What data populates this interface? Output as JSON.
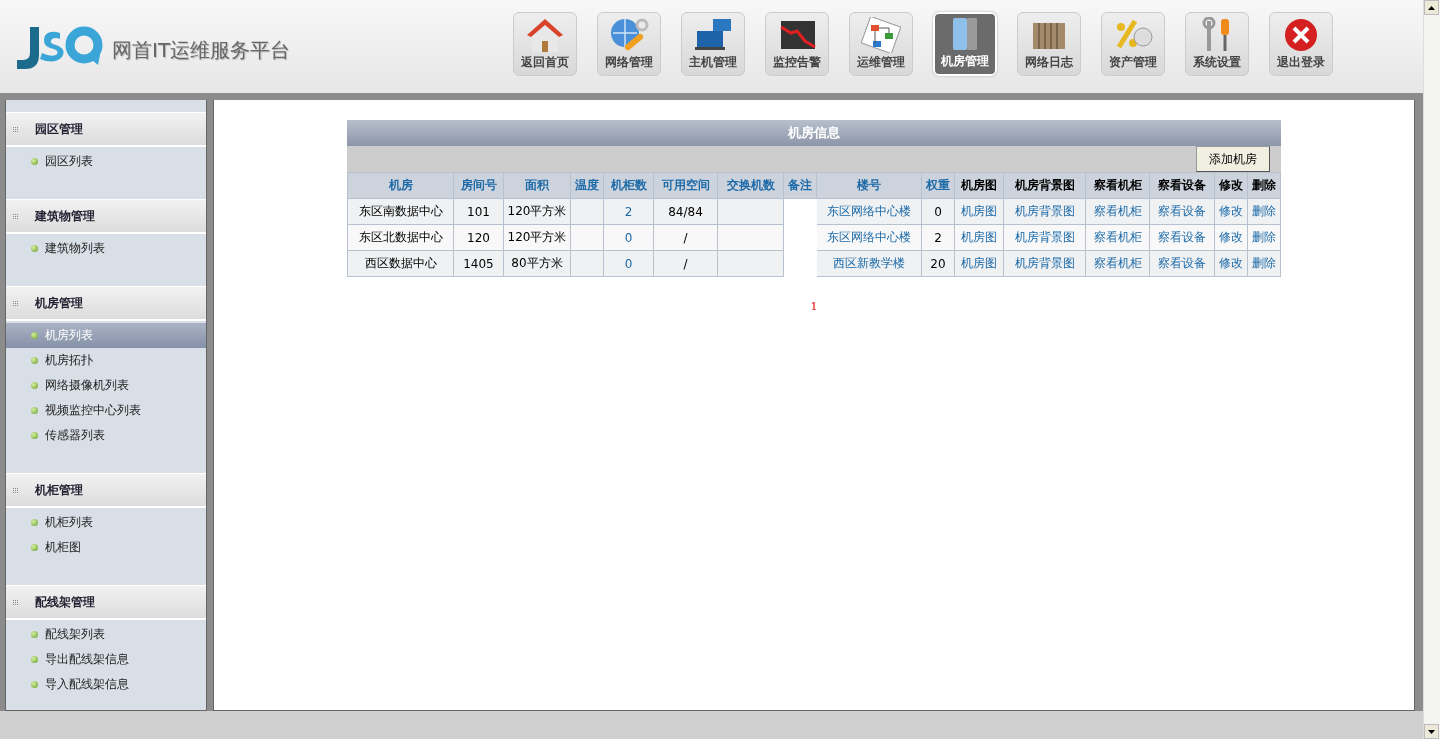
{
  "brand": {
    "title": "网首IT运维服务平台"
  },
  "nav": [
    {
      "label": "返回首页",
      "kind": "home",
      "selected": false
    },
    {
      "label": "网络管理",
      "kind": "network",
      "selected": false
    },
    {
      "label": "主机管理",
      "kind": "host",
      "selected": false
    },
    {
      "label": "监控告警",
      "kind": "monitor",
      "selected": false
    },
    {
      "label": "运维管理",
      "kind": "flow",
      "selected": false
    },
    {
      "label": "机房管理",
      "kind": "room",
      "selected": true
    },
    {
      "label": "网络日志",
      "kind": "log",
      "selected": false
    },
    {
      "label": "资产管理",
      "kind": "asset",
      "selected": false
    },
    {
      "label": "系统设置",
      "kind": "settings",
      "selected": false
    },
    {
      "label": "退出登录",
      "kind": "logout",
      "selected": false
    }
  ],
  "sidebar": {
    "groups": [
      {
        "title": "园区管理",
        "items": [
          {
            "label": "园区列表",
            "selected": false
          }
        ]
      },
      {
        "title": "建筑物管理",
        "items": [
          {
            "label": "建筑物列表",
            "selected": false
          }
        ]
      },
      {
        "title": "机房管理",
        "items": [
          {
            "label": "机房列表",
            "selected": true
          },
          {
            "label": "机房拓扑",
            "selected": false
          },
          {
            "label": "网络摄像机列表",
            "selected": false
          },
          {
            "label": "视频监控中心列表",
            "selected": false
          },
          {
            "label": "传感器列表",
            "selected": false
          }
        ]
      },
      {
        "title": "机柜管理",
        "items": [
          {
            "label": "机柜列表",
            "selected": false
          },
          {
            "label": "机柜图",
            "selected": false
          }
        ]
      },
      {
        "title": "配线架管理",
        "items": [
          {
            "label": "配线架列表",
            "selected": false
          },
          {
            "label": "导出配线架信息",
            "selected": false
          },
          {
            "label": "导入配线架信息",
            "selected": false
          }
        ]
      }
    ]
  },
  "table": {
    "title": "机房信息",
    "add_button": "添加机房",
    "columns": [
      {
        "label": "机房",
        "kind": "sortable"
      },
      {
        "label": "房间号",
        "kind": "sortable"
      },
      {
        "label": "面积",
        "kind": "sortable"
      },
      {
        "label": "温度",
        "kind": "sortable"
      },
      {
        "label": "机柜数",
        "kind": "sortable"
      },
      {
        "label": "可用空间",
        "kind": "sortable"
      },
      {
        "label": "交换机数",
        "kind": "sortable"
      },
      {
        "label": "备注",
        "kind": "sortable"
      },
      {
        "label": "楼号",
        "kind": "sortable"
      },
      {
        "label": "权重",
        "kind": "sortable"
      },
      {
        "label": "机房图",
        "kind": "plain"
      },
      {
        "label": "机房背景图",
        "kind": "plain"
      },
      {
        "label": "察看机柜",
        "kind": "plain"
      },
      {
        "label": "察看设备",
        "kind": "plain"
      },
      {
        "label": "修改",
        "kind": "plain"
      },
      {
        "label": "删除",
        "kind": "plain"
      }
    ],
    "rows": [
      [
        {
          "text": "东区南数据中心",
          "link": false
        },
        {
          "text": "101",
          "link": false
        },
        {
          "text": "120平方米",
          "link": false
        },
        null,
        {
          "text": "2",
          "link": true
        },
        {
          "text": "84/84",
          "link": false
        },
        null,
        null,
        {
          "text": "东区网络中心楼",
          "link": true
        },
        {
          "text": "0",
          "link": false
        },
        {
          "text": "机房图",
          "link": true
        },
        {
          "text": "机房背景图",
          "link": true
        },
        {
          "text": "察看机柜",
          "link": true
        },
        {
          "text": "察看设备",
          "link": true
        },
        {
          "text": "修改",
          "link": true
        },
        {
          "text": "删除",
          "link": true
        }
      ],
      [
        {
          "text": "东区北数据中心",
          "link": false
        },
        {
          "text": "120",
          "link": false
        },
        {
          "text": "120平方米",
          "link": false
        },
        null,
        {
          "text": "0",
          "link": true
        },
        {
          "text": "/",
          "link": false
        },
        null,
        null,
        {
          "text": "东区网络中心楼",
          "link": true
        },
        {
          "text": "2",
          "link": false
        },
        {
          "text": "机房图",
          "link": true
        },
        {
          "text": "机房背景图",
          "link": true
        },
        {
          "text": "察看机柜",
          "link": true
        },
        {
          "text": "察看设备",
          "link": true
        },
        {
          "text": "修改",
          "link": true
        },
        {
          "text": "删除",
          "link": true
        }
      ],
      [
        {
          "text": "西区数据中心",
          "link": false
        },
        {
          "text": "1405",
          "link": false
        },
        {
          "text": "80平方米",
          "link": false
        },
        null,
        {
          "text": "0",
          "link": true
        },
        {
          "text": "/",
          "link": false
        },
        null,
        null,
        {
          "text": "西区新教学楼",
          "link": true
        },
        {
          "text": "20",
          "link": false
        },
        {
          "text": "机房图",
          "link": true
        },
        {
          "text": "机房背景图",
          "link": true
        },
        {
          "text": "察看机柜",
          "link": true
        },
        {
          "text": "察看设备",
          "link": true
        },
        {
          "text": "修改",
          "link": true
        },
        {
          "text": "删除",
          "link": true
        }
      ]
    ],
    "pagination": [
      {
        "label": "1",
        "selected": true
      }
    ]
  }
}
